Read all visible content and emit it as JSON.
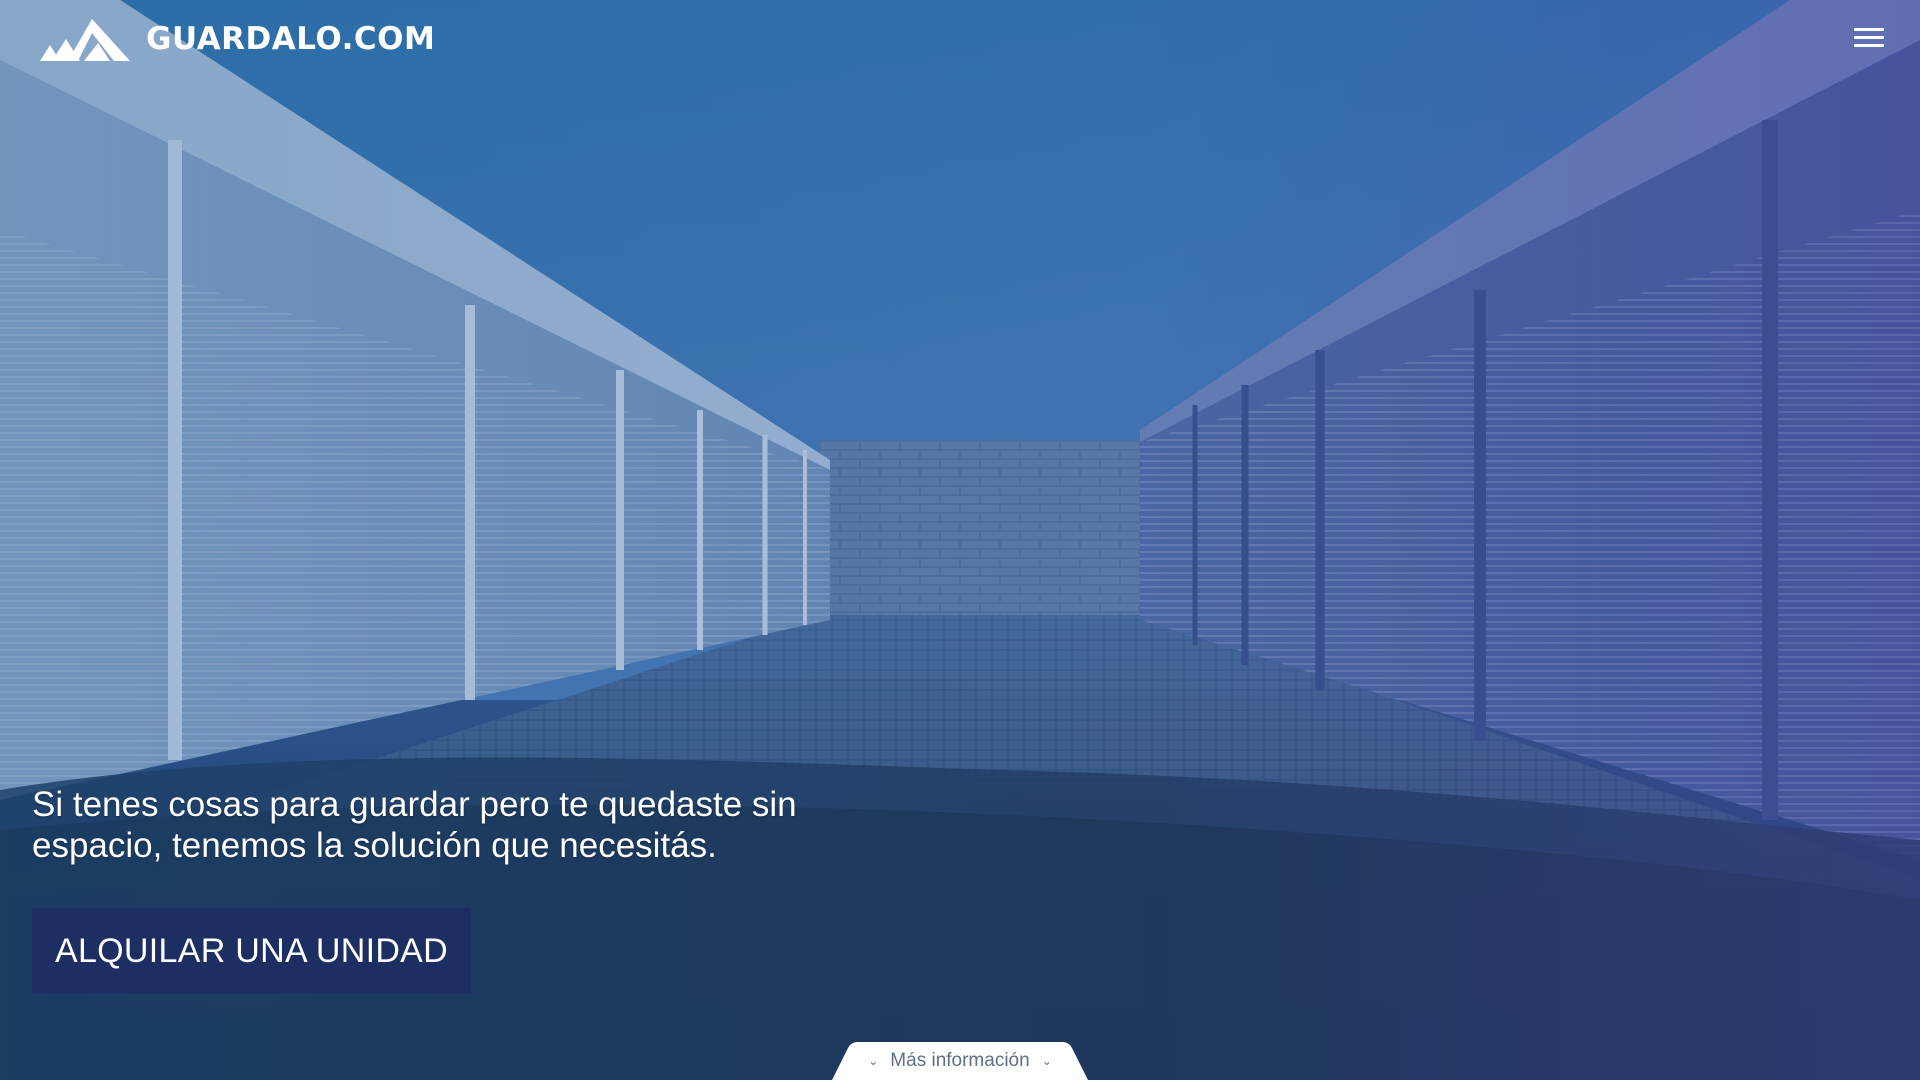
{
  "header": {
    "logo_text": "GUARDALO.COM",
    "menu_icon": "hamburger-menu-icon"
  },
  "hero": {
    "headline": "Si tenes cosas para guardar pero te quedaste sin espacio, tenemos la solución que necesitás.",
    "cta_label": "ALQUILAR UNA UNIDAD",
    "more_info_label": "Más información",
    "more_info_icon": "chevron-down-icon"
  },
  "colors": {
    "cta_background": "#1d2e63",
    "text_primary": "#ffffff",
    "more_info_text": "#5f6f86",
    "more_info_tab": "#ffffff"
  }
}
